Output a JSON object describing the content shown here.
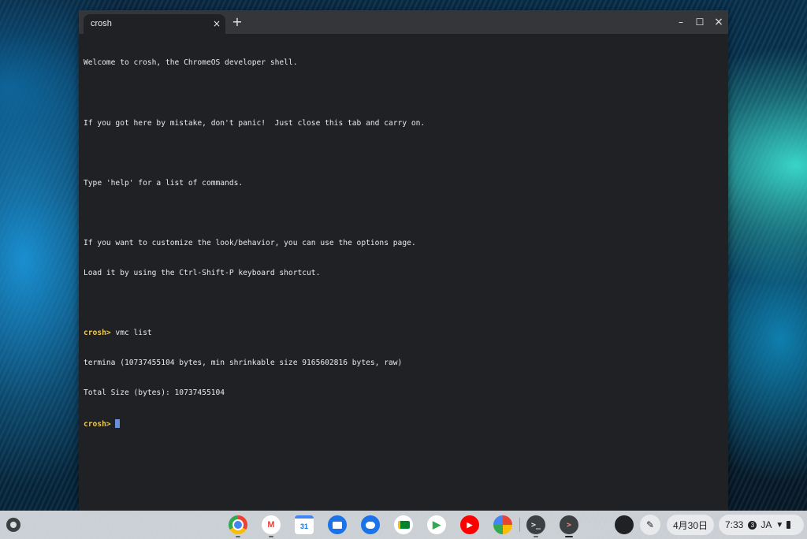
{
  "window": {
    "tab_title": "crosh",
    "tab_close": "×",
    "new_tab": "+",
    "minimize": "–",
    "maximize": "☐",
    "close": "×"
  },
  "terminal": {
    "lines": [
      "Welcome to crosh, the ChromeOS developer shell.",
      "",
      "If you got here by mistake, don't panic!  Just close this tab and carry on.",
      "",
      "Type 'help' for a list of commands.",
      "",
      "If you want to customize the look/behavior, you can use the options page.",
      "Load it by using the Ctrl-Shift-P keyboard shortcut.",
      ""
    ],
    "prompt": "crosh>",
    "command": " vmc list",
    "output": [
      "termina (10737455104 bytes, min shrinkable size 9165602816 bytes, raw)",
      "Total Size (bytes): 10737455104"
    ],
    "current_prompt": "crosh>"
  },
  "shelf": {
    "apps": [
      {
        "name": "chrome-icon",
        "label": ""
      },
      {
        "name": "gmail-icon",
        "label": "M"
      },
      {
        "name": "calendar-icon",
        "label": "31"
      },
      {
        "name": "files-icon",
        "label": ""
      },
      {
        "name": "messages-icon",
        "label": ""
      },
      {
        "name": "meet-icon",
        "label": ""
      },
      {
        "name": "play-store-icon",
        "label": "▶"
      },
      {
        "name": "youtube-icon",
        "label": "▶"
      },
      {
        "name": "photos-icon",
        "label": ""
      },
      {
        "name": "terminal-icon",
        "label": ">_"
      },
      {
        "name": "crosh-icon",
        "label": ">"
      }
    ],
    "date": "4月30日",
    "time": "7:33",
    "notification_count": "3",
    "ime": "JA"
  },
  "colors": {
    "terminal_bg": "#202124",
    "prompt": "#f2c94c",
    "cursor": "#6b8fd4"
  }
}
